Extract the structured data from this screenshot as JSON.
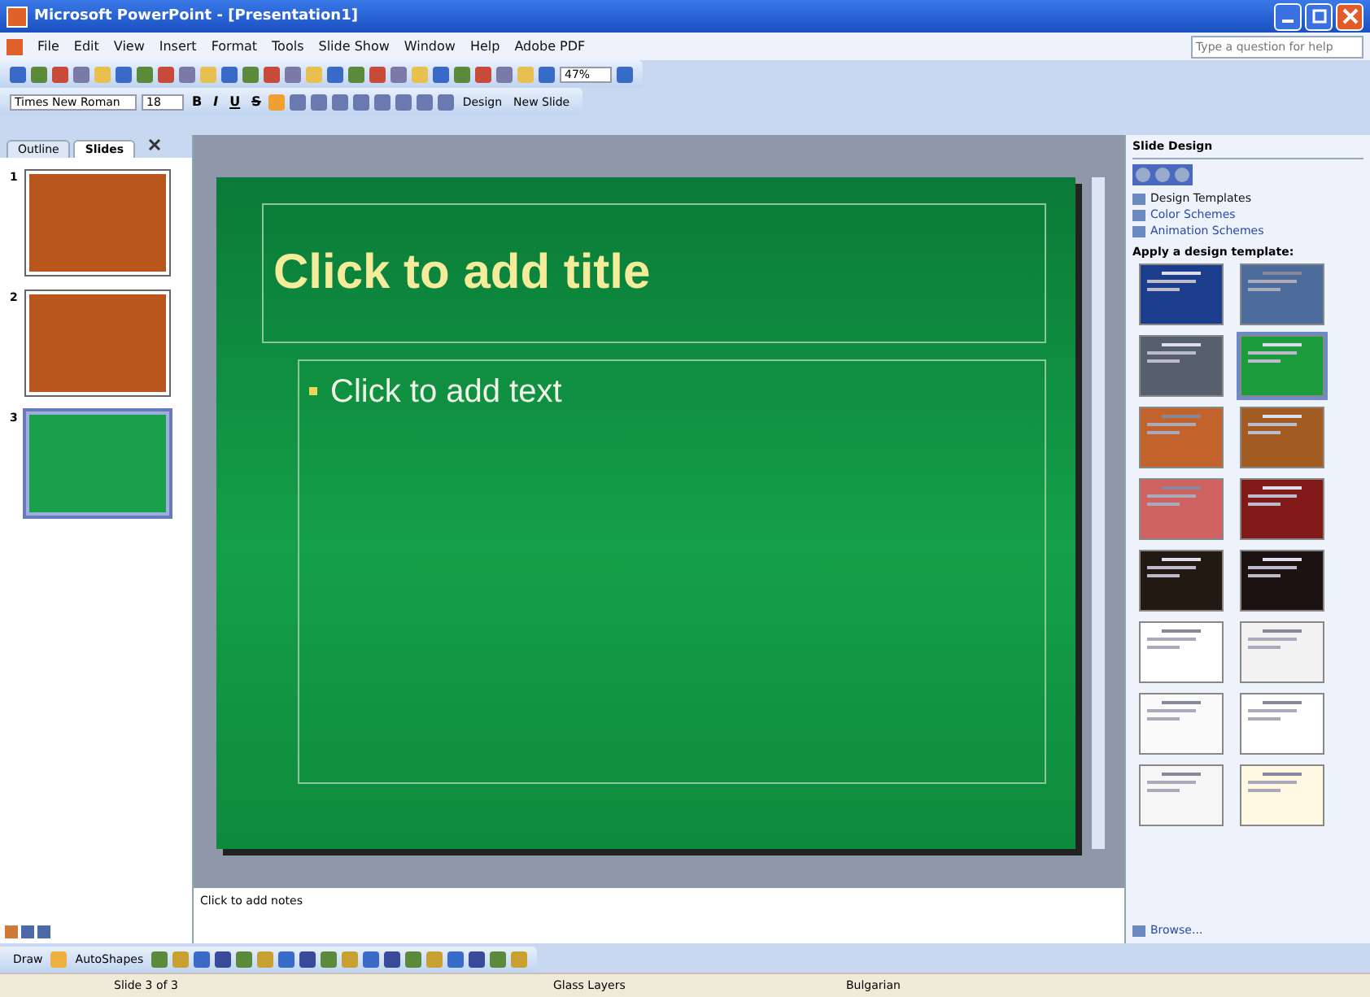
{
  "window": {
    "title": "Microsoft PowerPoint - [Presentation1]"
  },
  "menu": [
    "File",
    "Edit",
    "View",
    "Insert",
    "Format",
    "Tools",
    "Slide Show",
    "Window",
    "Help",
    "Adobe PDF"
  ],
  "help_box": {
    "placeholder": "Type a question for help"
  },
  "standard_toolbar": {
    "zoom": "47%"
  },
  "formatting_toolbar": {
    "font": "Times New Roman",
    "size": "18",
    "styles": [
      "B",
      "I",
      "U",
      "S"
    ],
    "design": "Design",
    "new_slide": "New Slide"
  },
  "pane_tabs": [
    {
      "label": "Outline",
      "selected": false
    },
    {
      "label": "Slides",
      "selected": true
    }
  ],
  "slides": [
    {
      "number": "1",
      "color": "#b8561e",
      "selected": false
    },
    {
      "number": "2",
      "color": "#b8561e",
      "selected": false
    },
    {
      "number": "3",
      "color": "#1aa04a",
      "selected": true
    }
  ],
  "slide": {
    "title": "Click to add title",
    "body": "Click to add text"
  },
  "notes": {
    "placeholder": "Click to add notes"
  },
  "task_pane": {
    "title": "Slide Design",
    "links": [
      "Design Templates",
      "Color Schemes",
      "Animation Schemes"
    ],
    "section": "Apply a design template:",
    "browse": "Browse..."
  },
  "templates": [
    {
      "color": "#1c3c8c",
      "selected": false
    },
    {
      "color": "#4c6c9c",
      "selected": false
    },
    {
      "color": "#56606c",
      "selected": false
    },
    {
      "color": "#1c9c3c",
      "selected": true
    },
    {
      "color": "#c2622c",
      "selected": false
    },
    {
      "color": "#a25c22",
      "selected": false
    },
    {
      "color": "#d06262",
      "selected": false
    },
    {
      "color": "#821a1a",
      "selected": false
    },
    {
      "color": "#221a12",
      "selected": false
    },
    {
      "color": "#1c1212",
      "selected": false
    },
    {
      "color": "#ffffff",
      "selected": false
    },
    {
      "color": "#f2f2f2",
      "selected": false
    },
    {
      "color": "#fafafa",
      "selected": false
    },
    {
      "color": "#ffffff",
      "selected": false
    },
    {
      "color": "#f6f6f6",
      "selected": false
    },
    {
      "color": "#fff8e2",
      "selected": false
    }
  ],
  "drawing_toolbar": {
    "draw": "Draw",
    "autoshapes": "AutoShapes"
  },
  "status_bar": [
    "Slide 3 of 3",
    "Glass Layers",
    "Bulgarian"
  ]
}
